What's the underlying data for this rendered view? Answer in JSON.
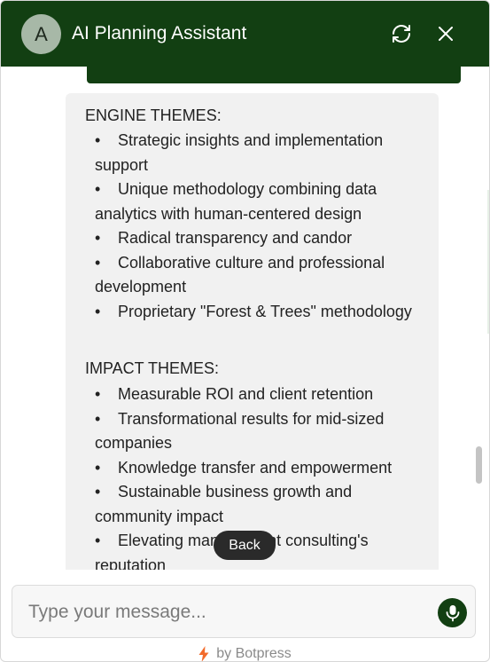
{
  "header": {
    "avatar_letter": "A",
    "title": "AI Planning Assistant",
    "refresh_icon": "refresh-icon",
    "close_icon": "close-icon",
    "background_color": "#123f12"
  },
  "message": {
    "sections": [
      {
        "heading": "ENGINE THEMES:",
        "items": [
          "Strategic insights and implementation support",
          "Unique methodology combining data analytics with human-centered design",
          "Radical transparency and candor",
          "Collaborative culture and professional development",
          "Proprietary \"Forest & Trees\" methodology"
        ]
      },
      {
        "heading": "IMPACT THEMES:",
        "items": [
          "Measurable ROI and client retention",
          "Transformational results for mid-sized companies",
          "Knowledge transfer and empowerment",
          "Sustainable business growth and community impact",
          "Elevating management consulting's reputation"
        ]
      }
    ]
  },
  "back_button": {
    "label": "Back"
  },
  "composer": {
    "placeholder": "Type your message...",
    "value": "",
    "mic_icon": "microphone-icon"
  },
  "footer": {
    "label": "by Botpress",
    "icon": "lightning-bolt-icon"
  }
}
